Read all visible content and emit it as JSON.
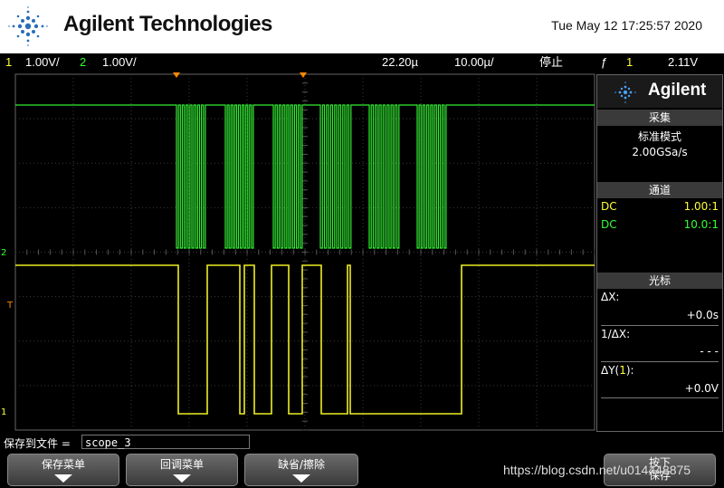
{
  "header": {
    "brand": "Agilent Technologies",
    "datetime": "Tue May 12 17:25:57 2020"
  },
  "status_bar": {
    "ch1_num": "1",
    "ch1_scale": "1.00V/",
    "ch2_num": "2",
    "ch2_scale": "1.00V/",
    "delay": "22.20µ",
    "timebase": "10.00µ/",
    "run_state": "停止",
    "trigger_symbol": "ƒ",
    "trigger_ch": "1",
    "trigger_level": "2.11V"
  },
  "markers": {
    "ch2": "2",
    "trigger": "T",
    "ch1": "1"
  },
  "right_panel": {
    "logo": "Agilent",
    "acq_title": "采集",
    "acq_mode": "标准模式",
    "acq_rate": "2.00GSa/s",
    "chan_title": "通道",
    "chan1_coupling": "DC",
    "chan1_probe": "1.00:1",
    "chan2_coupling": "DC",
    "chan2_probe": "10.0:1",
    "cursor_title": "光标",
    "dx_label": "ΔX:",
    "dx_value": "+0.0s",
    "inv_dx_label": "1/ΔX:",
    "inv_dx_value": "- - -",
    "dy_label_pre": "ΔY(",
    "dy_label_ch": "1",
    "dy_label_post": "):",
    "dy_value": "+0.0V"
  },
  "save": {
    "label": "保存到文件 =",
    "filename": "scope_3"
  },
  "softkeys": [
    {
      "label": "保存菜单"
    },
    {
      "label": "回调菜单"
    },
    {
      "label": "缺省/擦除"
    },
    {
      "label": "按下\n保存"
    }
  ],
  "watermark": "https://blog.csdn.net/u014448875",
  "colors": {
    "ch1": "#ffff33",
    "ch2": "#33ff33",
    "grid": "#555555",
    "panel_header": "#3a3a3a"
  }
}
